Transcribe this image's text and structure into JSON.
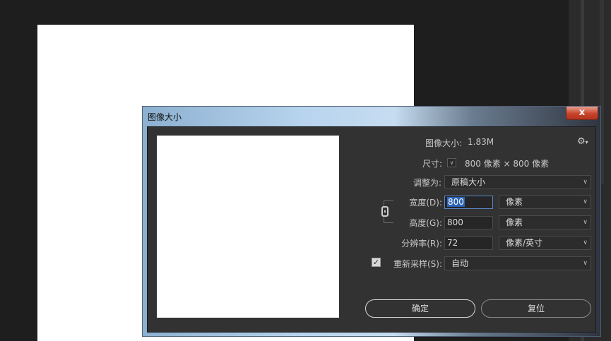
{
  "dialog": {
    "title": "图像大小",
    "close_label": "x"
  },
  "info": {
    "image_size_label": "图像大小:",
    "image_size_value": "1.83M",
    "dimensions_label": "尺寸:",
    "dimensions_value": "800 像素 × 800 像素"
  },
  "fit_to": {
    "label": "调整为:",
    "value": "原稿大小"
  },
  "width": {
    "label": "宽度(D):",
    "value": "800",
    "unit": "像素"
  },
  "height": {
    "label": "高度(G):",
    "value": "800",
    "unit": "像素"
  },
  "resolution": {
    "label": "分辨率(R):",
    "value": "72",
    "unit": "像素/英寸"
  },
  "resample": {
    "label": "重新采样(S):",
    "checked": true,
    "value": "自动"
  },
  "buttons": {
    "ok": "确定",
    "reset": "复位"
  },
  "icons": {
    "settings": "gear-icon",
    "link": "chain-link-icon",
    "dropdown": "chevron-down-icon"
  }
}
